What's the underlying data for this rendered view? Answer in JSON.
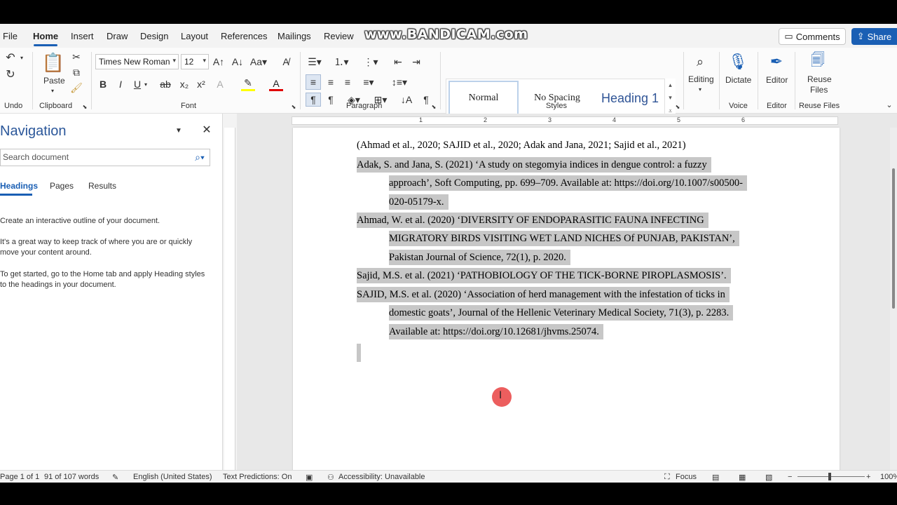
{
  "watermark": "www.BANDICAM.com",
  "tabs": [
    "File",
    "Home",
    "Insert",
    "Draw",
    "Design",
    "Layout",
    "References",
    "Mailings",
    "Review"
  ],
  "header": {
    "comments_label": "Comments",
    "share_label": "Share"
  },
  "ribbon": {
    "groups": {
      "undo": "Undo",
      "clipboard": "Clipboard",
      "font": "Font",
      "paragraph": "Paragraph",
      "styles": "Styles",
      "voice": "Voice",
      "editor": "Editor",
      "reuse": "Reuse Files"
    },
    "paste_label": "Paste",
    "font_name": "Times New Roman",
    "font_size": "12",
    "styles": [
      "Normal",
      "No Spacing",
      "Heading 1"
    ],
    "editing_label": "Editing",
    "dictate_label": "Dictate",
    "editor_label": "Editor",
    "reuse_label_1": "Reuse",
    "reuse_label_2": "Files"
  },
  "navigation": {
    "title": "Navigation",
    "search_placeholder": "Search document",
    "tabs": [
      "Headings",
      "Pages",
      "Results"
    ],
    "help_1": "Create an interactive outline of your document.",
    "help_2a": "It's a great way to keep track of where you are or quickly",
    "help_2b": "move your content around.",
    "help_3a": "To get started, go to the Home tab and apply Heading styles",
    "help_3b": "to the headings in your document."
  },
  "document": {
    "citation": "(Ahmad et al., 2020; SAJID et al., 2020; Adak and Jana, 2021; Sajid et al., 2021)",
    "ref1_l1": "Adak, S. and Jana, S. (2021) ‘A study on stegomyia indices in dengue control: a fuzzy",
    "ref1_l2": "approach’, Soft Computing, pp. 699–709. Available at: https://doi.org/10.1007/s00500-",
    "ref1_l3": "020-05179-x.",
    "ref2_l1": "Ahmad, W. et al. (2020) ‘DIVERSITY OF ENDOPARASITIC FAUNA INFECTING",
    "ref2_l2": "MIGRATORY BIRDS VISITING WET LAND NICHES Of PUNJAB, PAKISTAN’,",
    "ref2_l3": "Pakistan Journal of Science, 72(1), p. 2020.",
    "ref3_l1": "Sajid, M.S. et al. (2021) ‘PATHOBIOLOGY OF THE TICK-BORNE PIROPLASMOSIS’.",
    "ref4_l1": "SAJID, M.S. et al. (2020) ‘Association of herd management with the infestation of ticks in",
    "ref4_l2": "domestic goats’, Journal of the Hellenic Veterinary Medical Society, 71(3), p. 2283.",
    "ref4_l3": "Available at: https://doi.org/10.12681/jhvms.25074."
  },
  "status": {
    "page": "Page 1 of 1",
    "words": "91 of 107 words",
    "language": "English (United States)",
    "predictions": "Text Predictions: On",
    "accessibility": "Accessibility: Unavailable",
    "focus": "Focus",
    "zoom": "100%"
  },
  "colors": {
    "accent": "#1a5fb4",
    "highlight": "#c7c7c7",
    "click": "#e62828"
  }
}
